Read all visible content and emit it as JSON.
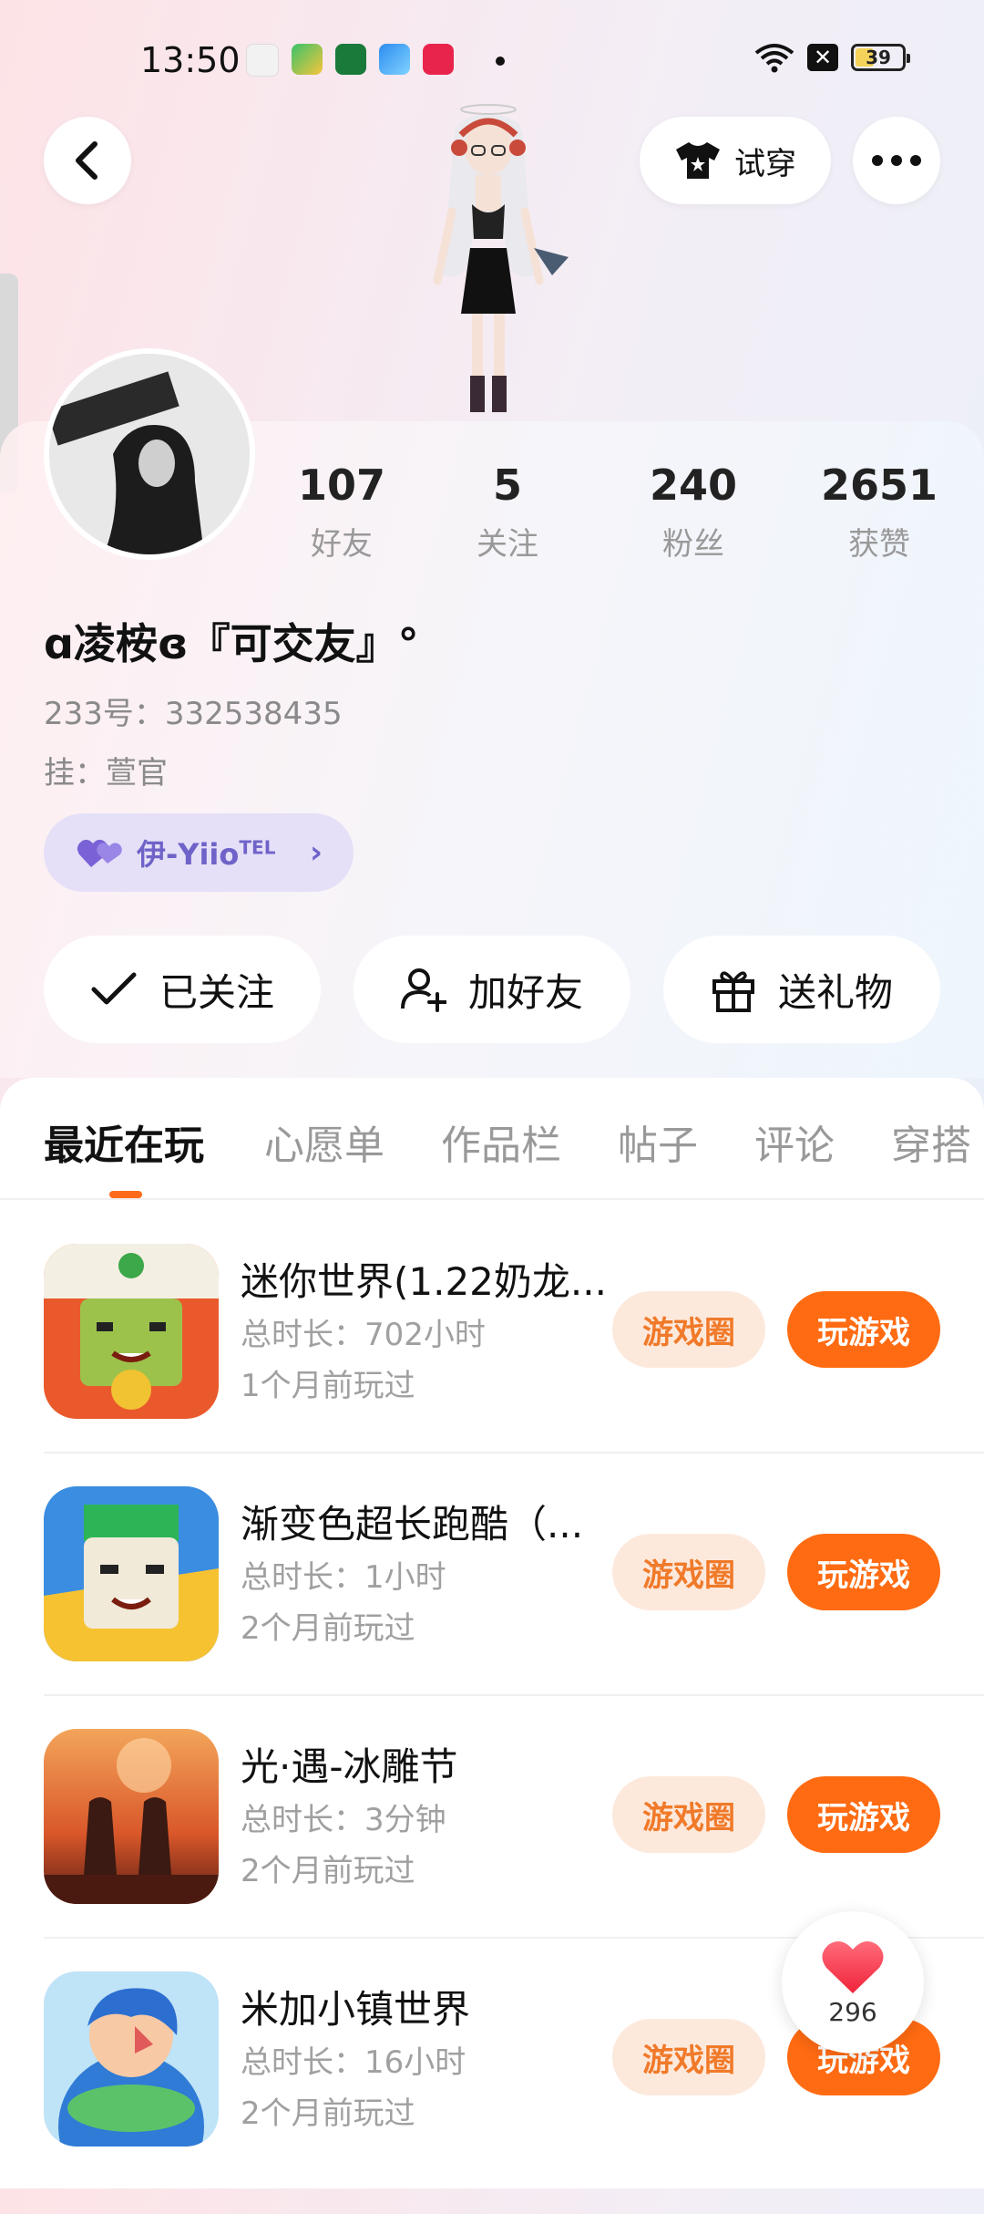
{
  "status_bar": {
    "time": "13:50",
    "battery": "39",
    "battery_level": 0.39
  },
  "top": {
    "try_on_label": "试穿"
  },
  "stats": [
    {
      "value": "107",
      "label": "好友"
    },
    {
      "value": "5",
      "label": "关注"
    },
    {
      "value": "240",
      "label": "粉丝"
    },
    {
      "value": "2651",
      "label": "获赞"
    }
  ],
  "profile": {
    "nickname": "ɑ凌桉ɞ『可交友』°",
    "uid": "233号：332538435",
    "hang": "挂：萱官",
    "couple_name": "伊-Yiio",
    "couple_sup": "TEL"
  },
  "actions": {
    "followed": "已关注",
    "add_friend": "加好友",
    "gift": "送礼物"
  },
  "tabs": [
    "最近在玩",
    "心愿单",
    "作品栏",
    "帖子",
    "评论",
    "穿搭"
  ],
  "games": [
    {
      "name": "迷你世界(1.22奶龙...",
      "duration": "总时长：702小时",
      "ago": "1个月前玩过",
      "circle": "游戏圈",
      "play": "玩游戏"
    },
    {
      "name": "渐变色超长跑酷（...",
      "duration": "总时长：1小时",
      "ago": "2个月前玩过",
      "circle": "游戏圈",
      "play": "玩游戏"
    },
    {
      "name": "光·遇-冰雕节",
      "duration": "总时长：3分钟",
      "ago": "2个月前玩过",
      "circle": "游戏圈",
      "play": "玩游戏"
    },
    {
      "name": "米加小镇世界",
      "duration": "总时长：16小时",
      "ago": "2个月前玩过",
      "circle": "游戏圈",
      "play": "玩游戏"
    }
  ],
  "like_count": "296",
  "colors": {
    "accent": "#ff6b12",
    "accent_soft": "#fde9dc",
    "couple_bg": "#e5e0f7",
    "couple_text": "#6f63c9"
  }
}
